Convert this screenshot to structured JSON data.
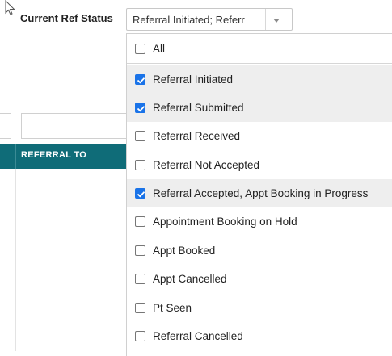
{
  "filter": {
    "label": "Current Ref Status",
    "selected_display": "Referral Initiated; Referr"
  },
  "grid": {
    "header": "REFERRAL TO"
  },
  "dropdown": {
    "options": [
      {
        "label": "All",
        "checked": false
      },
      {
        "label": "Referral Initiated",
        "checked": true
      },
      {
        "label": "Referral Submitted",
        "checked": true
      },
      {
        "label": "Referral Received",
        "checked": false
      },
      {
        "label": "Referral Not Accepted",
        "checked": false
      },
      {
        "label": "Referral Accepted, Appt Booking in Progress",
        "checked": true
      },
      {
        "label": "Appointment Booking on Hold",
        "checked": false
      },
      {
        "label": "Appt Booked",
        "checked": false
      },
      {
        "label": "Appt Cancelled",
        "checked": false
      },
      {
        "label": "Pt Seen",
        "checked": false
      },
      {
        "label": "Referral Cancelled",
        "checked": false
      }
    ]
  },
  "colors": {
    "header_bg": "#0f6c78",
    "checkbox_checked": "#1a73e8",
    "selected_row_bg": "#eeeeee"
  }
}
